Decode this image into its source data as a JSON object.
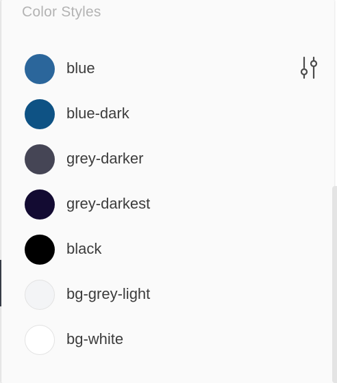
{
  "panel": {
    "title": "Color Styles"
  },
  "colors": [
    {
      "name": "blue",
      "hex": "#2b669b",
      "outlined": false
    },
    {
      "name": "blue-dark",
      "hex": "#0e5284",
      "outlined": false
    },
    {
      "name": "grey-darker",
      "hex": "#454555",
      "outlined": false
    },
    {
      "name": "grey-darkest",
      "hex": "#130b32",
      "outlined": false
    },
    {
      "name": "black",
      "hex": "#000000",
      "outlined": false
    },
    {
      "name": "bg-grey-light",
      "hex": "#f3f4f6",
      "outlined": true
    },
    {
      "name": "bg-white",
      "hex": "#ffffff",
      "outlined": true
    }
  ],
  "icons": {
    "settings": "sliders-icon"
  }
}
